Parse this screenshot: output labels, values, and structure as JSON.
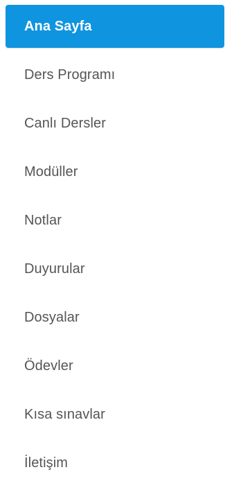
{
  "menu": {
    "items": [
      {
        "label": "Ana Sayfa",
        "active": true
      },
      {
        "label": "Ders Programı",
        "active": false
      },
      {
        "label": "Canlı Dersler",
        "active": false
      },
      {
        "label": "Modüller",
        "active": false
      },
      {
        "label": "Notlar",
        "active": false
      },
      {
        "label": "Duyurular",
        "active": false
      },
      {
        "label": "Dosyalar",
        "active": false
      },
      {
        "label": "Ödevler",
        "active": false
      },
      {
        "label": "Kısa sınavlar",
        "active": false
      },
      {
        "label": "İletişim",
        "active": false
      }
    ],
    "active_color": "#0f94e0",
    "text_color": "#555555"
  }
}
